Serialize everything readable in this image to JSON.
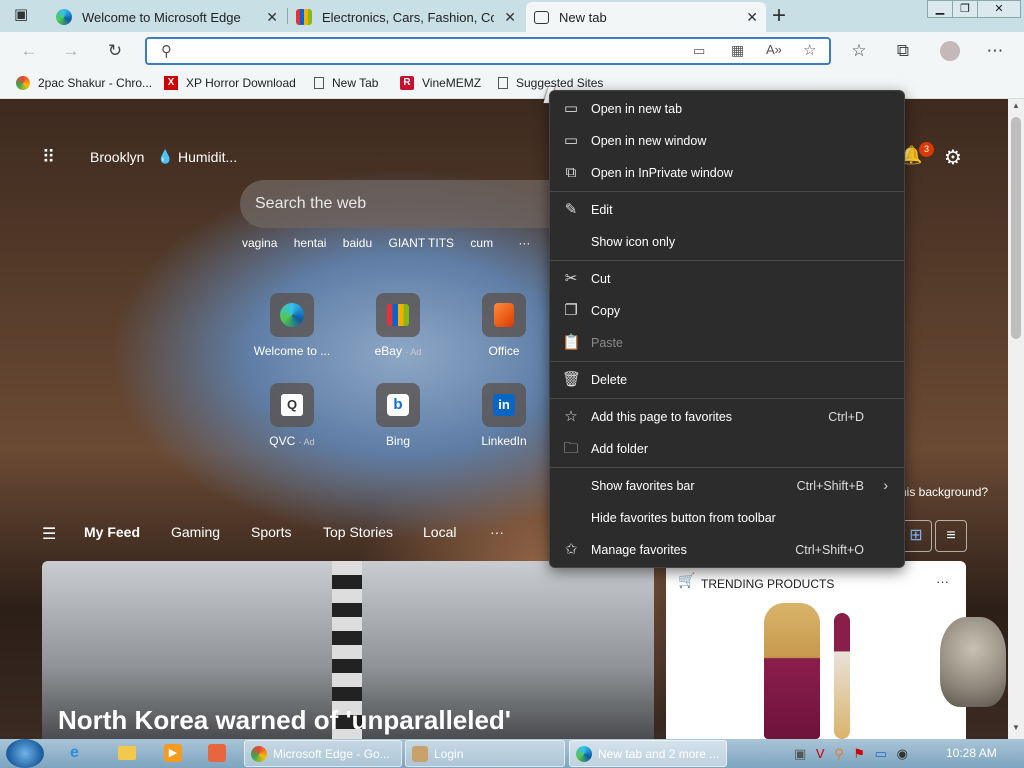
{
  "tabs": [
    {
      "title": "Welcome to Microsoft Edge",
      "close": "✕"
    },
    {
      "title": "Electronics, Cars, Fashion, Collect",
      "close": "✕"
    },
    {
      "title": "New tab",
      "close": "✕"
    }
  ],
  "new_tab_symbol": "+",
  "window_controls": {
    "minimize": "▁",
    "restore": "❐",
    "close": "✕"
  },
  "address_bar": {
    "value": "",
    "placeholder": ""
  },
  "favorites_bar": [
    {
      "label": "2pac Shakur - Chro..."
    },
    {
      "label": "XP Horror Download"
    },
    {
      "label": "New Tab"
    },
    {
      "label": "VineMEMZ"
    },
    {
      "label": "Suggested Sites"
    }
  ],
  "newtab": {
    "location": "Brooklyn",
    "weather": "Humidit...",
    "search_placeholder": "Search the web",
    "trending_searches": [
      "vagina",
      "hentai",
      "baidu",
      "GIANT TITS",
      "cum"
    ],
    "more": "···",
    "notifications_count": "3",
    "quick_links": [
      {
        "label": "Welcome to ..."
      },
      {
        "label": "eBay",
        "ad": "Ad"
      },
      {
        "label": "Office"
      },
      {
        "label": "QVC",
        "ad": "Ad"
      },
      {
        "label": "Bing"
      },
      {
        "label": "LinkedIn"
      }
    ],
    "background_question": "his background?",
    "feed_tabs": [
      "My Feed",
      "Gaming",
      "Sports",
      "Top Stories",
      "Local"
    ],
    "feed_more": "···",
    "headline": "North Korea warned of 'unparalleled'",
    "trending_header": "TRENDING PRODUCTS",
    "trending_more": "···"
  },
  "context_menu": {
    "items": [
      {
        "label": "Open in new tab",
        "icon": "open-new-tab-icon",
        "key": ""
      },
      {
        "label": "Open in new window",
        "icon": "window-icon",
        "key": ""
      },
      {
        "label": "Open in InPrivate window",
        "icon": "inprivate-icon",
        "key": ""
      },
      {
        "label": "Edit",
        "icon": "pencil-icon",
        "key": ""
      },
      {
        "label": "Show icon only",
        "icon": "",
        "key": ""
      },
      {
        "label": "Cut",
        "icon": "scissors-icon",
        "key": ""
      },
      {
        "label": "Copy",
        "icon": "copy-icon",
        "key": ""
      },
      {
        "label": "Paste",
        "icon": "paste-icon",
        "key": "",
        "disabled": true
      },
      {
        "label": "Delete",
        "icon": "trash-icon",
        "key": ""
      },
      {
        "label": "Add this page to favorites",
        "icon": "star-add-icon",
        "key": "Ctrl+D"
      },
      {
        "label": "Add folder",
        "icon": "folder-add-icon",
        "key": ""
      },
      {
        "label": "Show favorites bar",
        "icon": "",
        "key": "Ctrl+Shift+B"
      },
      {
        "label": "Hide favorites button from toolbar",
        "icon": "",
        "key": ""
      },
      {
        "label": "Manage favorites",
        "icon": "star-gear-icon",
        "key": "Ctrl+Shift+O"
      }
    ]
  },
  "taskbar": {
    "buttons": [
      {
        "label": "Microsoft Edge - Go..."
      },
      {
        "label": "Login"
      },
      {
        "label": "New tab and 2 more ..."
      }
    ],
    "clock": "10:28 AM"
  },
  "colors": {
    "accent": "#3c7bc8",
    "tabstrip": "#c9dfe6",
    "menu_bg": "#2c2c2c",
    "badge": "#d83b01"
  }
}
